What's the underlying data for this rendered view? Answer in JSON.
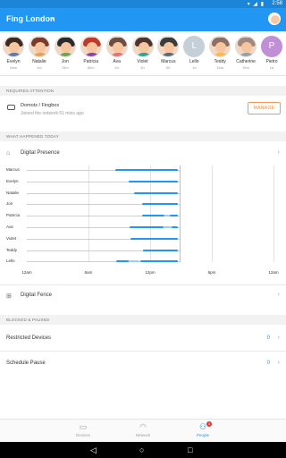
{
  "status": {
    "time": "2:58",
    "icons": "▾ ◢ ▮"
  },
  "appbar": {
    "network_name": "Fing London",
    "caret": "⌄"
  },
  "people": [
    {
      "name": "Evelyn",
      "ago": "Now",
      "hair": "#3e2a20",
      "shirt": "#5b7bb5"
    },
    {
      "name": "Natalie",
      "ago": "1m",
      "hair": "#7b3a2a",
      "shirt": "#e7a34a"
    },
    {
      "name": "Jon",
      "ago": "15m",
      "hair": "#2b2b2b",
      "shirt": "#6aa84f"
    },
    {
      "name": "Patricia",
      "ago": "50m",
      "hair": "#c0392b",
      "shirt": "#8e44ad"
    },
    {
      "name": "Ava",
      "ago": "4h",
      "hair": "#6d4c41",
      "shirt": "#e57373"
    },
    {
      "name": "Violet",
      "ago": "4h",
      "hair": "#4e342e",
      "shirt": "#26a69a"
    },
    {
      "name": "Marcus",
      "ago": "5h",
      "hair": "#3b3b3b",
      "shirt": "#546e7a"
    },
    {
      "name": "Lello",
      "ago": "1d",
      "letter": "L",
      "color": "#c5cfd8"
    },
    {
      "name": "Teddy",
      "ago": "34m",
      "hair": "#8d6e63",
      "shirt": "#ffb74d"
    },
    {
      "name": "Catherine",
      "ago": "35m",
      "hair": "#a1887f",
      "shirt": "#90a4ae"
    },
    {
      "name": "Pietro",
      "ago": "1d",
      "letter": "P",
      "color": "#c08fd6"
    }
  ],
  "attention": {
    "header": "REQUIRES ATTENTION",
    "title": "Domotz / Fingbox",
    "subtitle": "Joined the network 51 mins ago",
    "manage": "MANAGE"
  },
  "happened": {
    "header": "WHAT HAPPENED TODAY",
    "presence_label": "Digital Presence",
    "fence_label": "Digital Fence"
  },
  "chart_data": {
    "type": "timeline",
    "title": "Digital Presence",
    "axis_ticks": [
      "12am",
      "6am",
      "12pm",
      "6pm",
      "12am"
    ],
    "x_unit": "hours since 12am",
    "xlim": [
      0,
      24
    ],
    "now_hour": 14.9,
    "rows": [
      {
        "name": "Marcus",
        "segments": [
          [
            8.6,
            14.7
          ]
        ]
      },
      {
        "name": "Evelyn",
        "segments": [
          [
            9.9,
            14.7
          ]
        ]
      },
      {
        "name": "Natalie",
        "segments": [
          [
            10.4,
            14.7
          ]
        ]
      },
      {
        "name": "Jon",
        "segments": [
          [
            11.2,
            14.7
          ]
        ]
      },
      {
        "name": "Patricia",
        "segments": [
          [
            11.2,
            13.4
          ],
          [
            13.9,
            14.7
          ]
        ]
      },
      {
        "name": "Ava",
        "segments": [
          [
            10.0,
            13.3
          ],
          [
            14.1,
            14.7
          ]
        ]
      },
      {
        "name": "Violet",
        "segments": [
          [
            10.1,
            14.7
          ]
        ]
      },
      {
        "name": "Teddy",
        "segments": [
          [
            11.3,
            14.7
          ]
        ]
      },
      {
        "name": "Lello",
        "segments": [
          [
            8.7,
            9.9
          ],
          [
            11.0,
            14.7
          ]
        ]
      }
    ]
  },
  "blocked": {
    "header": "BLOCKED & PAUSED",
    "restricted_label": "Restricted Devices",
    "restricted_count": "0",
    "schedule_label": "Schedule Pause",
    "schedule_count": "0"
  },
  "nav": {
    "devices": "Devices",
    "network": "Network",
    "people": "People",
    "people_badge": "1"
  },
  "colors": {
    "accent": "#2196f3",
    "manage": "#f08a3e"
  }
}
